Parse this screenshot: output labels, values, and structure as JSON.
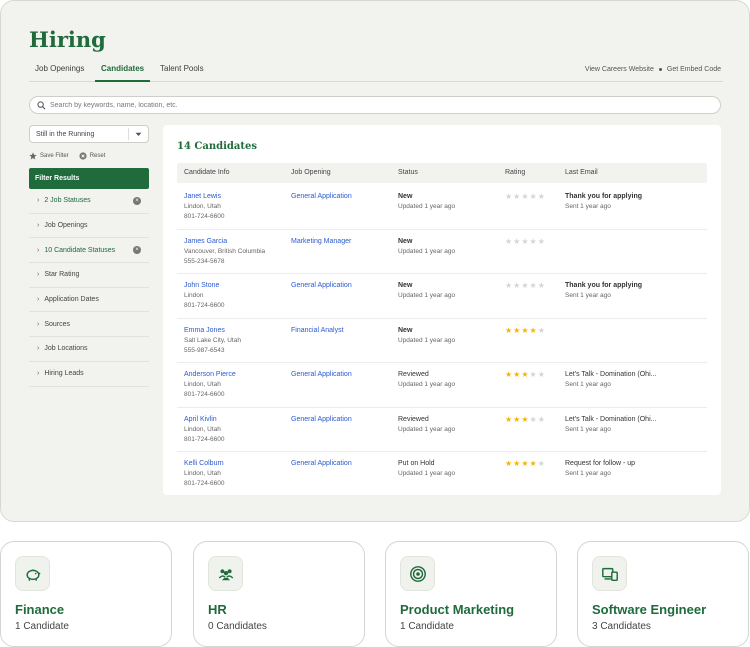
{
  "app": {
    "title": "Hiring",
    "tabs": [
      "Job Openings",
      "Candidates",
      "Talent Pools"
    ],
    "active_tab": "Candidates",
    "header_links": [
      "View Careers Website",
      "Get Embed Code"
    ],
    "accent_color": "#1f6b3c"
  },
  "search": {
    "placeholder": "Search by keywords, name, location, etc."
  },
  "sidebar": {
    "status_select": "Still in the Running",
    "save_filter": "Save Filter",
    "reset": "Reset",
    "filter_results_label": "Filter Results",
    "filters": [
      {
        "label": "2 Job Statuses",
        "applied": true
      },
      {
        "label": "Job Openings",
        "applied": false
      },
      {
        "label": "10 Candidate Statuses",
        "applied": true
      },
      {
        "label": "Star Rating",
        "applied": false
      },
      {
        "label": "Application Dates",
        "applied": false
      },
      {
        "label": "Sources",
        "applied": false
      },
      {
        "label": "Job Locations",
        "applied": false
      },
      {
        "label": "Hiring Leads",
        "applied": false
      }
    ]
  },
  "main": {
    "count_label": "14 Candidates",
    "columns": [
      "Candidate Info",
      "Job Opening",
      "Status",
      "Rating",
      "Last Email"
    ],
    "candidates": [
      {
        "name": "Janet Lewis",
        "location": "Lindon, Utah",
        "phone": "801-724-6600",
        "job": "General Application",
        "status": "New",
        "updated": "Updated 1 year ago",
        "rating": 0,
        "email_subject": "Thank you for applying",
        "email_sent": "Sent 1 year ago"
      },
      {
        "name": "James Garcia",
        "location": "Vancouver, British Columbia",
        "phone": "555-234-5678",
        "job": "Marketing Manager",
        "status": "New",
        "updated": "Updated 1 year ago",
        "rating": 0,
        "email_subject": "",
        "email_sent": ""
      },
      {
        "name": "John Stone",
        "location": "Lindon",
        "phone": "801-724-6600",
        "job": "General Application",
        "status": "New",
        "updated": "Updated 1 year ago",
        "rating": 0,
        "email_subject": "Thank you for applying",
        "email_sent": "Sent 1 year ago"
      },
      {
        "name": "Emma Jones",
        "location": "Salt Lake City, Utah",
        "phone": "555-987-6543",
        "job": "Financial Analyst",
        "status": "New",
        "updated": "Updated 1 year ago",
        "rating": 4,
        "email_subject": "",
        "email_sent": ""
      },
      {
        "name": "Anderson Pierce",
        "location": "Lindon, Utah",
        "phone": "801-724-6600",
        "job": "General Application",
        "status": "Reviewed",
        "updated": "Updated 1 year ago",
        "rating": 3,
        "email_subject": "Let's Talk - Domination (Ohi...",
        "email_sent": "Sent 1 year ago"
      },
      {
        "name": "April Kivlin",
        "location": "Lindon, Utah",
        "phone": "801-724-6600",
        "job": "General Application",
        "status": "Reviewed",
        "updated": "Updated 1 year ago",
        "rating": 3,
        "email_subject": "Let's Talk - Domination (Ohi...",
        "email_sent": "Sent 1 year ago"
      },
      {
        "name": "Kelli Colburn",
        "location": "Lindon, Utah",
        "phone": "801-724-6600",
        "job": "General Application",
        "status": "Put on Hold",
        "updated": "Updated 1 year ago",
        "rating": 4,
        "email_subject": "Request for follow - up",
        "email_sent": "Sent 1 year ago"
      }
    ]
  },
  "categories": [
    {
      "title": "Finance",
      "count": "1 Candidate",
      "icon": "piggy-bank-icon"
    },
    {
      "title": "HR",
      "count": "0 Candidates",
      "icon": "people-icon"
    },
    {
      "title": "Product Marketing",
      "count": "1 Candidate",
      "icon": "target-icon"
    },
    {
      "title": "Software Engineer",
      "count": "3 Candidates",
      "icon": "devices-icon"
    }
  ]
}
